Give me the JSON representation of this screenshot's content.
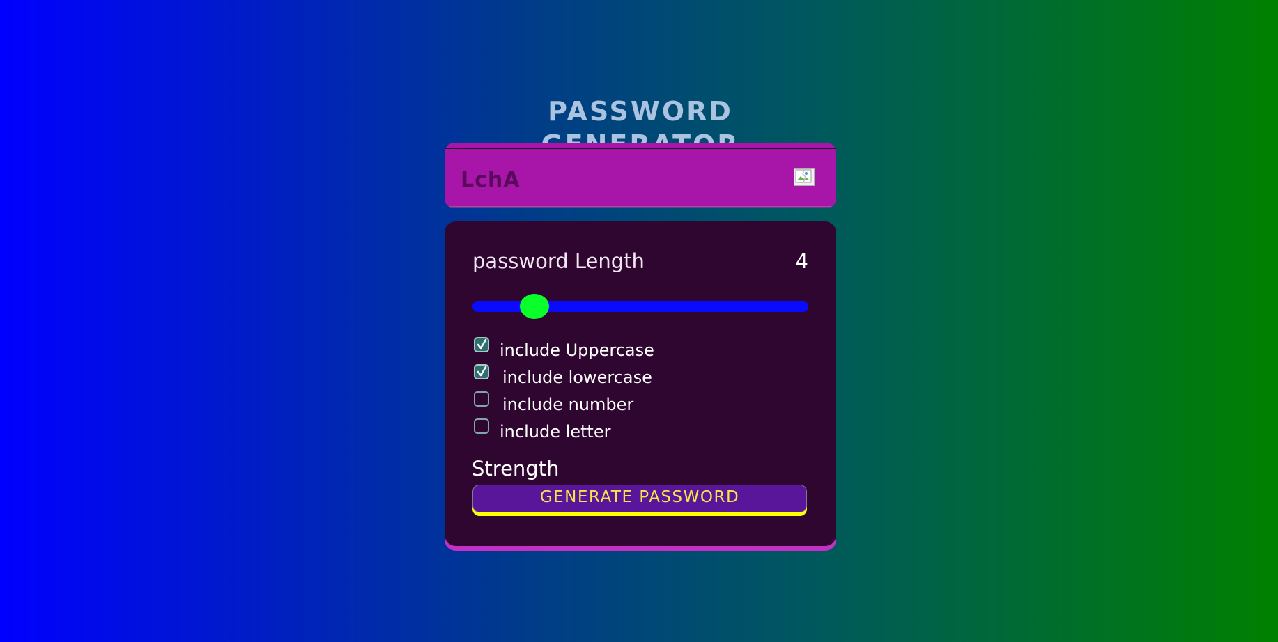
{
  "page": {
    "title": "PASSWORD GENERATOR"
  },
  "display": {
    "password": "LchA",
    "copy_icon": "broken-image-icon"
  },
  "length": {
    "label": "password Length",
    "value": "4",
    "slider_fraction": 0.185
  },
  "options": [
    {
      "label": "include Uppercase",
      "checked": true
    },
    {
      "label": "include lowercase",
      "checked": true
    },
    {
      "label": "include number",
      "checked": false
    },
    {
      "label": "include letter",
      "checked": false
    }
  ],
  "strength": {
    "label": "Strength"
  },
  "generate": {
    "label": "GENERATE PASSWORD"
  },
  "colors": {
    "background_start": "#0000ff",
    "background_end": "#008000",
    "display_bg": "#a716a8",
    "panel_bg": "#2f0630",
    "panel_accent": "#c530c4",
    "slider_track": "#0a0aff",
    "slider_thumb": "#0aff2a",
    "button_bg": "#5a169a",
    "button_text": "#f2e64a",
    "button_accent": "#ffff00"
  }
}
